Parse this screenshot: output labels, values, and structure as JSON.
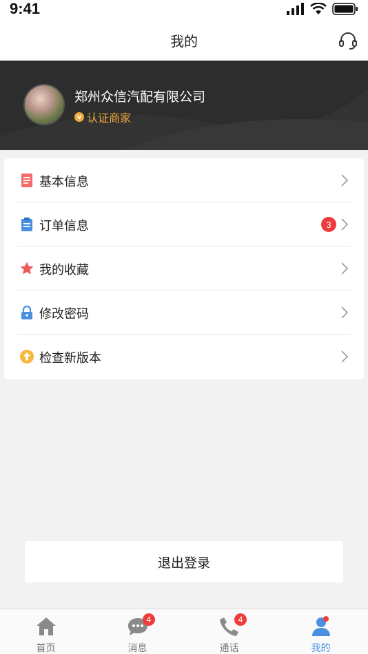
{
  "status_bar": {
    "time": "9:41"
  },
  "nav": {
    "title": "我的",
    "support_icon": "headset-icon"
  },
  "profile": {
    "company_name": "郑州众信汽配有限公司",
    "cert_label": "认证商家",
    "cert_badge": "v",
    "accent_color": "#f0a93a"
  },
  "menu": {
    "items": [
      {
        "label": "基本信息",
        "icon": "document-icon"
      },
      {
        "label": "订单信息",
        "icon": "clipboard-icon",
        "badge": "3"
      },
      {
        "label": "我的收藏",
        "icon": "star-icon"
      },
      {
        "label": "修改密码",
        "icon": "lock-icon"
      },
      {
        "label": "检查新版本",
        "icon": "upgrade-icon"
      }
    ]
  },
  "logout": {
    "label": "退出登录"
  },
  "tabs": [
    {
      "label": "首页",
      "icon": "home-icon"
    },
    {
      "label": "消息",
      "icon": "chat-icon",
      "badge": "4"
    },
    {
      "label": "通话",
      "icon": "phone-icon",
      "badge": "4"
    },
    {
      "label": "我的",
      "icon": "user-icon",
      "active": true
    }
  ],
  "colors": {
    "active_tab": "#4a90e2",
    "badge": "#ee3b3b"
  }
}
